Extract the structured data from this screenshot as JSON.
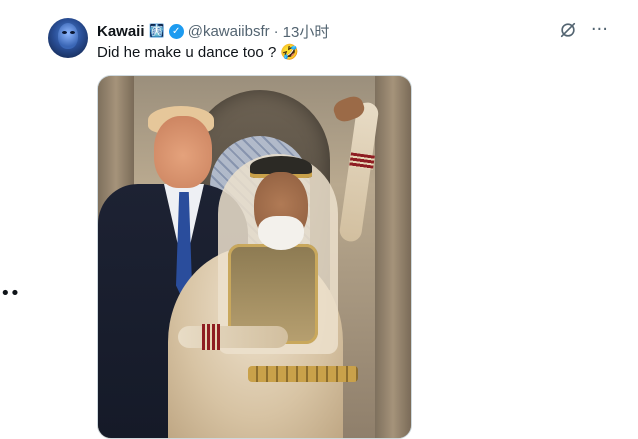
{
  "side": {
    "ellipsis": "••"
  },
  "tweet": {
    "author_name": "Kawaii",
    "badge_emoji": "🩻",
    "verified_symbol": "✓",
    "handle": "@kawaiibsfr",
    "separator": "·",
    "time": "13小时",
    "text": "Did he make u dance too ?",
    "text_emoji": "🤣",
    "more_symbol": "···"
  },
  "colors": {
    "verified": "#1d9bf0",
    "secondary_text": "#536471",
    "primary_text": "#0f1419"
  },
  "icons": [
    "grok-icon",
    "more-icon",
    "verified-icon",
    "avatar"
  ]
}
